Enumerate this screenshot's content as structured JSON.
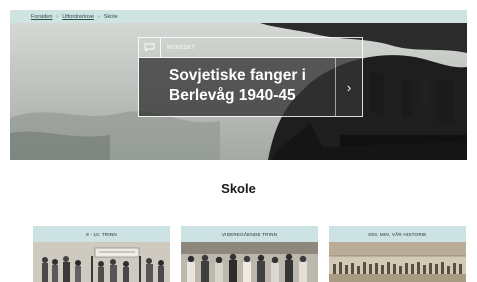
{
  "breadcrumb": {
    "items": [
      "Forsiden",
      "Utfordrerlove",
      "Skole"
    ],
    "separator": "›"
  },
  "hero": {
    "tag": "Nordset",
    "title_line1": "Sovjetiske fanger i",
    "title_line2": "Berlevåg 1940-45",
    "arrow": "›",
    "colors": {
      "card_bg": "#343434",
      "border": "#ffffff"
    }
  },
  "main": {
    "title": "Skole"
  },
  "tiles": [
    {
      "label": "8 - 10. trinn"
    },
    {
      "label": "Videregående trinn"
    },
    {
      "label": "Din, min, vår historie"
    }
  ],
  "colors": {
    "accent": "#cde2e2",
    "text": "#1a1a1a"
  }
}
